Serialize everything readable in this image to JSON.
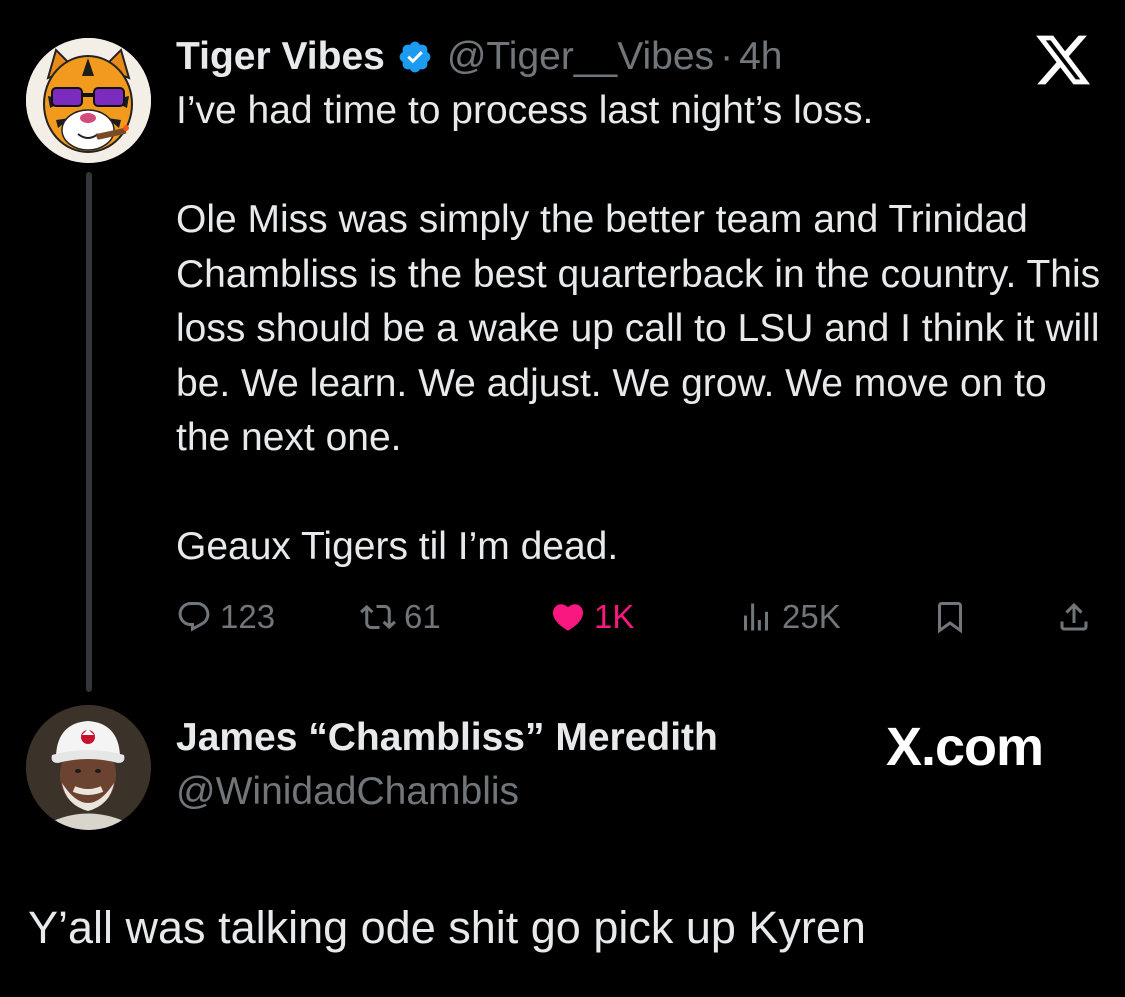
{
  "tweet": {
    "author": {
      "display_name": "Tiger Vibes",
      "handle": "@Tiger__Vibes",
      "separator": "·",
      "time": "4h",
      "verified": true
    },
    "paragraphs": [
      "I’ve had time to process last night’s loss.",
      "Ole Miss was simply the better team and Trinidad Chambliss is the best quarterback in the country. This loss should be a wake up call to LSU and I think it will be. We learn. We adjust. We grow. We move on to the next one.",
      "Geaux Tigers til I’m dead."
    ],
    "stats": {
      "replies": "123",
      "reposts": "61",
      "likes": "1K",
      "views": "25K"
    },
    "icons": [
      "x-logo-icon",
      "verified-badge-icon",
      "reply-icon",
      "repost-icon",
      "like-icon",
      "views-icon",
      "bookmark-icon",
      "share-icon"
    ]
  },
  "reply": {
    "display_name": "James “Chambliss” Meredith",
    "handle": "@WinidadChamblis",
    "watermark": "X.com"
  },
  "caption": "Y’all was talking ode shit go pick up Kyren",
  "colors": {
    "background": "#000000",
    "text": "#e7e9ea",
    "muted": "#71767b",
    "verified": "#1d9bf0",
    "like": "#f91880",
    "thread_line": "#333639"
  }
}
